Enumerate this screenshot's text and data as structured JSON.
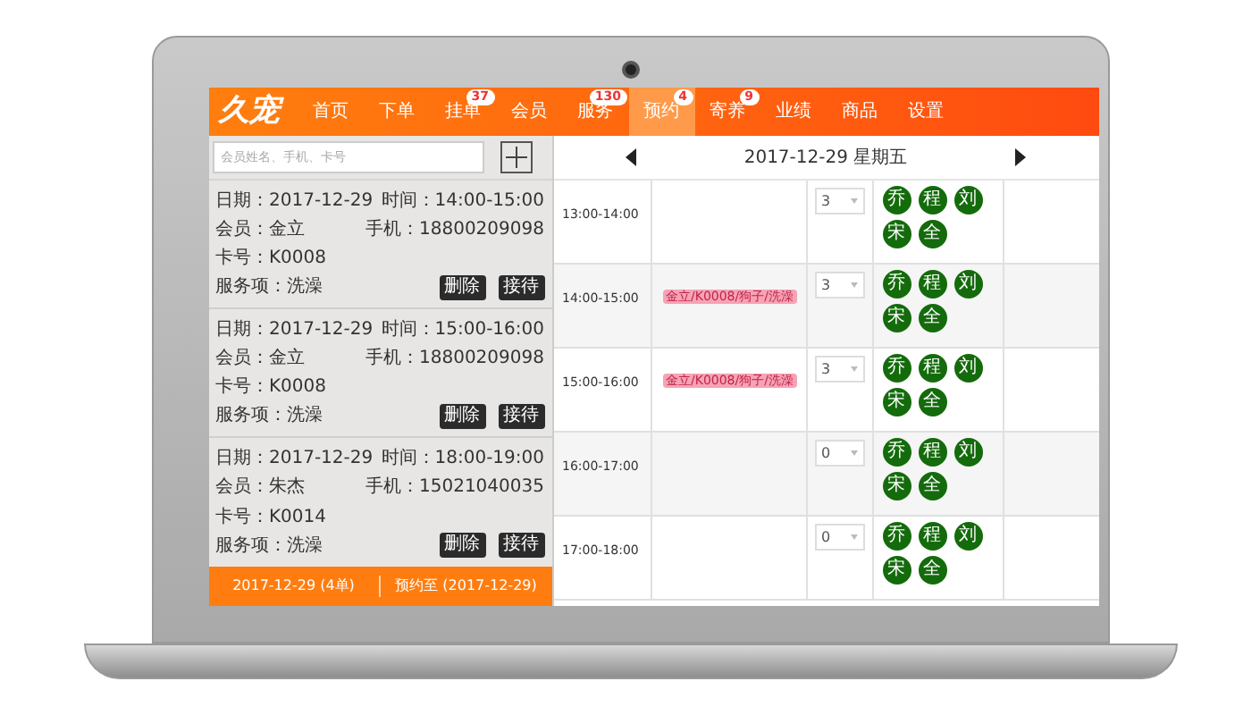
{
  "logo": "久宠",
  "nav": [
    {
      "label": "首页",
      "selected": false
    },
    {
      "label": "下单",
      "selected": false
    },
    {
      "label": "挂单",
      "badge": "37",
      "selected": false
    },
    {
      "label": "会员",
      "selected": false
    },
    {
      "label": "服务",
      "badge": "130",
      "selected": false
    },
    {
      "label": "预约",
      "badge": "4",
      "selected": true
    },
    {
      "label": "寄养",
      "badge": "9",
      "selected": false
    },
    {
      "label": "业绩",
      "selected": false
    },
    {
      "label": "商品",
      "selected": false
    },
    {
      "label": "设置",
      "selected": false
    }
  ],
  "search": {
    "placeholder": "会员姓名、手机、卡号"
  },
  "appointments": [
    {
      "date_label": "日期：",
      "date": "2017-12-29",
      "time_label": "时间：",
      "time": "14:00-15:00",
      "member_label": "会员：",
      "member": "金立",
      "phone_label": "手机：",
      "phone": "18800209098",
      "card_label": "卡号：",
      "card": "K0008",
      "service_label": "服务项：",
      "service": "洗澡",
      "actions": [
        "删除",
        "接待"
      ]
    },
    {
      "date_label": "日期：",
      "date": "2017-12-29",
      "time_label": "时间：",
      "time": "15:00-16:00",
      "member_label": "会员：",
      "member": "金立",
      "phone_label": "手机：",
      "phone": "18800209098",
      "card_label": "卡号：",
      "card": "K0008",
      "service_label": "服务项：",
      "service": "洗澡",
      "actions": [
        "删除",
        "接待"
      ]
    },
    {
      "date_label": "日期：",
      "date": "2017-12-29",
      "time_label": "时间：",
      "time": "18:00-19:00",
      "member_label": "会员：",
      "member": "朱杰",
      "phone_label": "手机：",
      "phone": "15021040035",
      "card_label": "卡号：",
      "card": "K0014",
      "service_label": "服务项：",
      "service": "洗澡",
      "actions": [
        "删除",
        "接待"
      ]
    }
  ],
  "footer": {
    "left": "2017-12-29 (4单)",
    "right": "预约至 (2017-12-29)"
  },
  "schedule_date": "2017-12-29 星期五",
  "slots": [
    {
      "time": "13:00-14:00",
      "count": "3",
      "staff": [
        "乔",
        "程",
        "刘",
        "宋",
        "全"
      ]
    },
    {
      "time": "14:00-15:00",
      "booking": "金立/K0008/狗子/洗澡",
      "count": "3",
      "staff": [
        "乔",
        "程",
        "刘",
        "宋",
        "全"
      ]
    },
    {
      "time": "15:00-16:00",
      "booking": "金立/K0008/狗子/洗澡",
      "count": "3",
      "staff": [
        "乔",
        "程",
        "刘",
        "宋",
        "全"
      ]
    },
    {
      "time": "16:00-17:00",
      "count": "0",
      "staff": [
        "乔",
        "程",
        "刘",
        "宋",
        "全"
      ]
    },
    {
      "time": "17:00-18:00",
      "count": "0",
      "staff": [
        "乔",
        "程",
        "刘",
        "宋",
        "全"
      ]
    }
  ]
}
